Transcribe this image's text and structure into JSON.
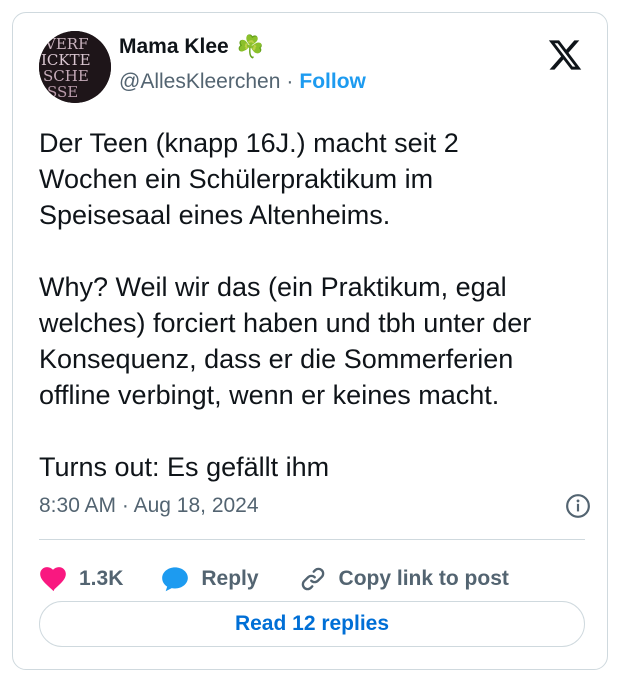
{
  "author": {
    "display_name": "Mama Klee",
    "emoji": "☘️",
    "handle": "@AllesKleerchen",
    "separator": "·",
    "follow_label": "Follow",
    "avatar_text": [
      "VERF",
      "ICKTE",
      "SCHE",
      "SSE"
    ]
  },
  "tweet": {
    "text": "Der Teen (knapp 16J.) macht seit 2\nWochen ein Schülerpraktikum im\nSpeisesaal eines Altenheims.\n\nWhy? Weil wir das (ein Praktikum, egal\nwelches) forciert haben und tbh unter der\nKonsequenz, dass er die Sommerferien\noffline verbingt, wenn er keines macht.\n\nTurns out: Es gefällt ihm",
    "time": "8:30 AM",
    "date": "Aug 18, 2024",
    "meta_separator": "·"
  },
  "actions": {
    "likes": "1.3K",
    "reply_label": "Reply",
    "copy_label": "Copy link to post"
  },
  "read_replies_label": "Read 12 replies",
  "icons": {
    "like": "heart-icon",
    "reply": "speech-bubble-icon",
    "copy": "link-icon",
    "info": "info-icon",
    "logo": "x-logo-icon"
  },
  "colors": {
    "like": "#f91880",
    "reply": "#1d9bf0",
    "follow": "#1d9bf0",
    "read_button_text": "#006fd6",
    "muted": "#536471",
    "border": "#cfd9de"
  }
}
